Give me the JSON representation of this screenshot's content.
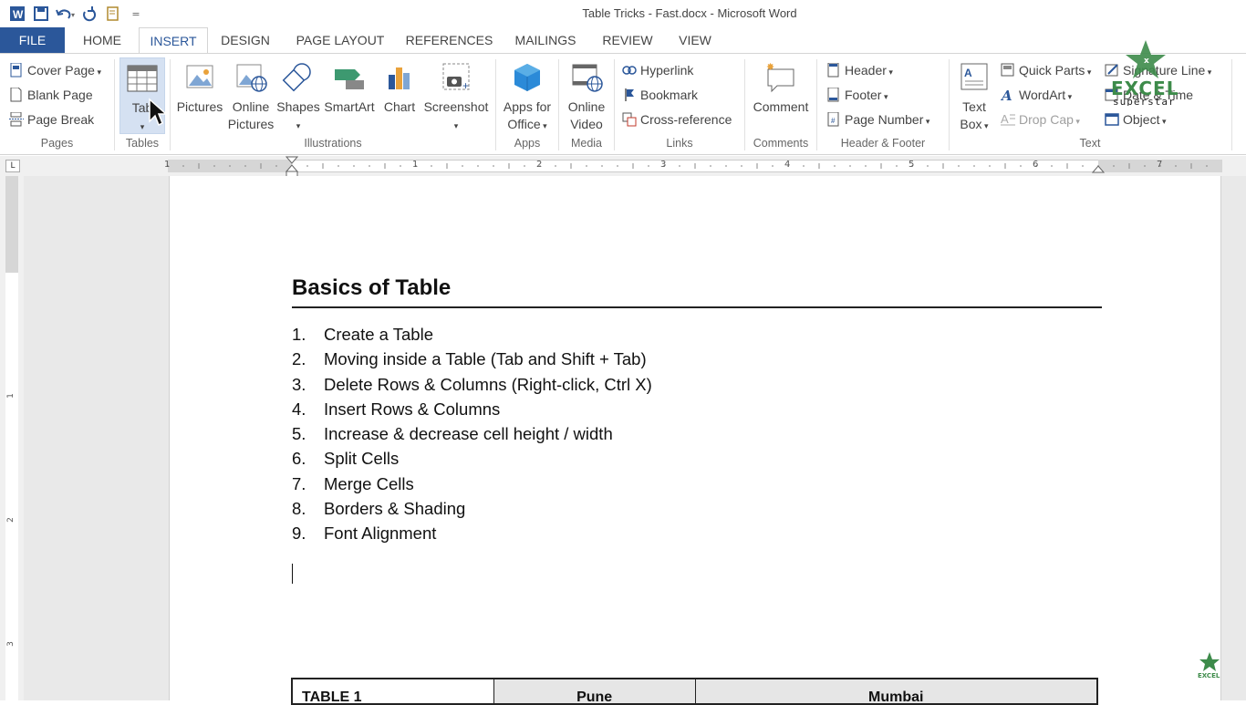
{
  "window": {
    "title": "Table Tricks - Fast.docx - Microsoft Word"
  },
  "tabs": [
    {
      "label": "FILE"
    },
    {
      "label": "HOME"
    },
    {
      "label": "INSERT"
    },
    {
      "label": "DESIGN"
    },
    {
      "label": "PAGE LAYOUT"
    },
    {
      "label": "REFERENCES"
    },
    {
      "label": "MAILINGS"
    },
    {
      "label": "REVIEW"
    },
    {
      "label": "VIEW"
    }
  ],
  "ribbon": {
    "pages": {
      "cover": "Cover Page",
      "blank": "Blank Page",
      "break": "Page Break",
      "group": "Pages"
    },
    "tables": {
      "table": "Tab",
      "group": "Tables"
    },
    "illustrations": {
      "pictures": "Pictures",
      "online1": "Online",
      "online2": "Pictures",
      "shapes": "Shapes",
      "smartart": "SmartArt",
      "chart": "Chart",
      "screenshot": "Screenshot",
      "group": "Illustrations"
    },
    "apps": {
      "l1": "Apps for",
      "l2": "Office",
      "group": "Apps"
    },
    "media": {
      "l1": "Online",
      "l2": "Video",
      "group": "Media"
    },
    "links": {
      "hyperlink": "Hyperlink",
      "bookmark": "Bookmark",
      "crossref": "Cross-reference",
      "group": "Links"
    },
    "comments": {
      "comment": "Comment",
      "group": "Comments"
    },
    "headerfooter": {
      "header": "Header",
      "footer": "Footer",
      "pagenumber": "Page Number",
      "group": "Header & Footer"
    },
    "text": {
      "textbox1": "Text",
      "textbox2": "Box",
      "quickparts": "Quick Parts",
      "wordart": "WordArt",
      "dropcap": "Drop Cap",
      "sigline": "Signature Line",
      "datetime": "Date & Time",
      "object": "Object",
      "group": "Text"
    }
  },
  "watermark": {
    "brand": "EXCEL",
    "sub": "superstar"
  },
  "ruler": {
    "labels": [
      "1",
      "1",
      "2",
      "3",
      "4",
      "5",
      "6",
      "7"
    ],
    "vlabels": [
      "1",
      "2",
      "3"
    ]
  },
  "doc": {
    "heading": "Basics of Table",
    "items": [
      {
        "n": "1.",
        "t": "Create a Table"
      },
      {
        "n": "2.",
        "t": "Moving inside a Table (Tab and Shift + Tab)"
      },
      {
        "n": "3.",
        "t": "Delete Rows & Columns (Right-click, Ctrl X)"
      },
      {
        "n": "4.",
        "t": "Insert Rows & Columns"
      },
      {
        "n": "5.",
        "t": "Increase & decrease cell height / width"
      },
      {
        "n": "6.",
        "t": "Split Cells"
      },
      {
        "n": "7.",
        "t": "Merge Cells"
      },
      {
        "n": "8.",
        "t": "Borders & Shading"
      },
      {
        "n": "9.",
        "t": "Font Alignment"
      }
    ],
    "table": {
      "c1": "TABLE 1",
      "c2": "Pune",
      "c3": "Mumbai"
    }
  },
  "colors": {
    "accent": "#2b579a"
  }
}
